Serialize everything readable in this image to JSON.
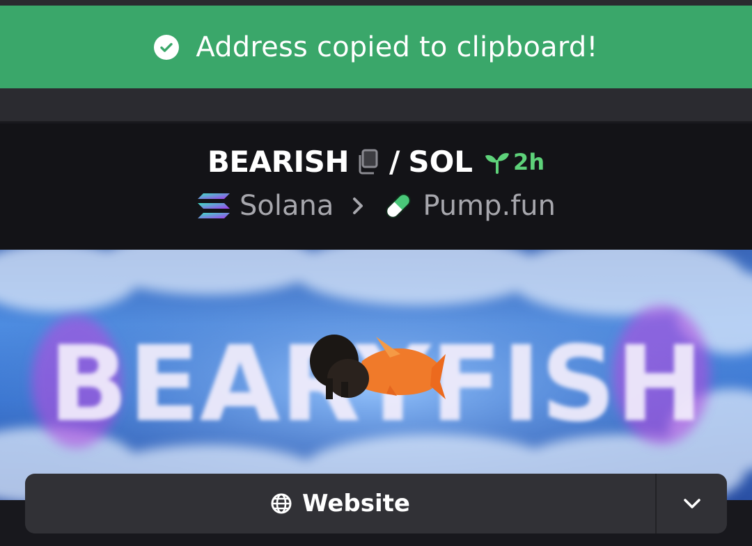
{
  "toast": {
    "message": "Address copied to clipboard!",
    "icon": "check-circle-icon",
    "color": "#3aa76a"
  },
  "pair": {
    "base": "BEARISH",
    "separator": "/",
    "quote": "SOL",
    "age": "2h",
    "age_icon": "sprout-icon",
    "age_color": "#5ed27a"
  },
  "breadcrumb": {
    "chain": "Solana",
    "dex": "Pump.fun"
  },
  "banner": {
    "art_text": "BEARYFISH",
    "description": "banner-image"
  },
  "actions": {
    "website_label": "Website",
    "website_icon": "globe-icon",
    "dropdown_icon": "chevron-down-icon"
  }
}
